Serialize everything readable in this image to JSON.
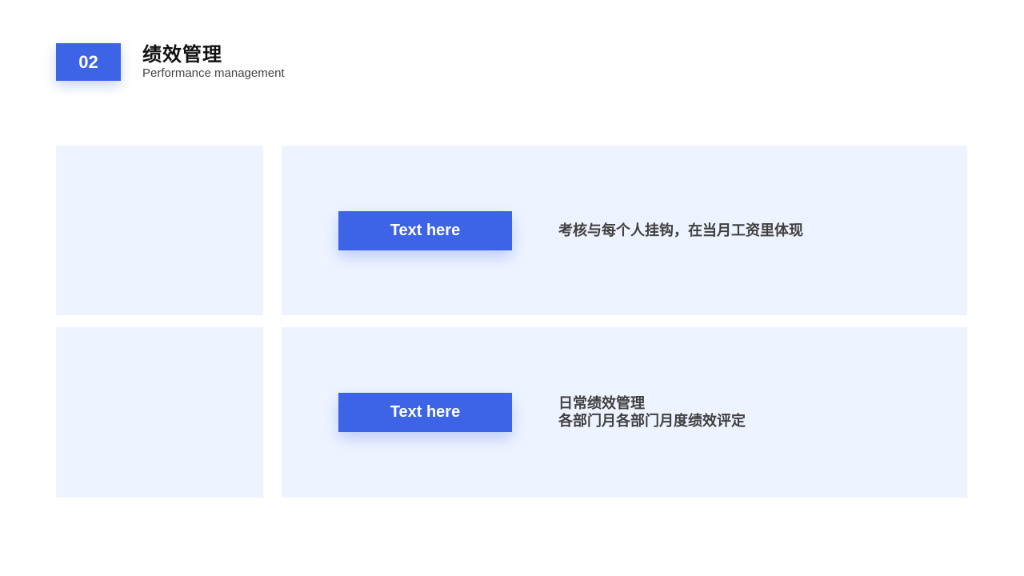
{
  "header": {
    "section_number": "02",
    "title": "绩效管理",
    "subtitle": "Performance management"
  },
  "rows": [
    {
      "button_label": "Text here",
      "lines": [
        "考核与每个人挂钩，在当月工资里体现"
      ]
    },
    {
      "button_label": "Text here",
      "lines": [
        "日常绩效管理",
        "各部门月各部门月度绩效评定"
      ]
    }
  ],
  "colors": {
    "accent": "#3d63e6",
    "panel": "#eef4ff",
    "text_dark": "#404040",
    "background": "#ffffff"
  }
}
